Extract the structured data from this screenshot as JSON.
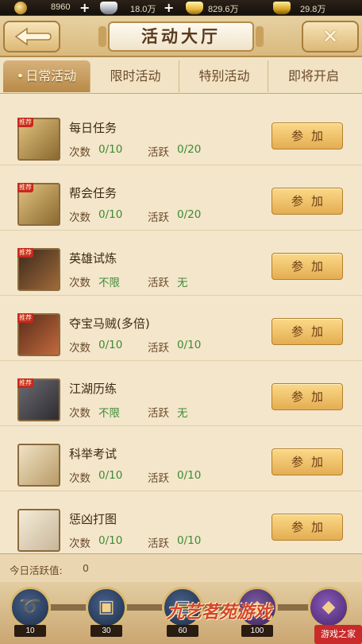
{
  "currency": [
    {
      "icon": "coin-icon",
      "value": "8960",
      "has_plus": true
    },
    {
      "icon": "silver-icon",
      "value": "18.0万",
      "has_plus": true
    },
    {
      "icon": "gold-ingot-icon",
      "value": "829.6万",
      "has_plus": false
    },
    {
      "icon": "yuanbao-icon",
      "value": "29.8万",
      "has_plus": false
    }
  ],
  "header": {
    "title": "活动大厅",
    "back_icon": "back-arrow-icon",
    "close_icon": "close-icon",
    "close_glyph": "✕"
  },
  "tabs": [
    {
      "label": "日常活动",
      "active": true
    },
    {
      "label": "限时活动",
      "active": false
    },
    {
      "label": "特别活动",
      "active": false
    },
    {
      "label": "即将开启",
      "active": false
    }
  ],
  "labels": {
    "count": "次数",
    "activity": "活跃",
    "join": "参加",
    "recommend": "推荐"
  },
  "activities": [
    {
      "name": "每日任务",
      "count": "0/10",
      "activity": "0/20",
      "icon": "task-ticket-icon",
      "recommended": true
    },
    {
      "name": "帮会任务",
      "count": "0/10",
      "activity": "0/20",
      "icon": "guild-ticket-icon",
      "recommended": true
    },
    {
      "name": "英雄试炼",
      "count": "不限",
      "activity": "无",
      "icon": "hero-trial-icon",
      "recommended": true
    },
    {
      "name": "夺宝马贼(多倍)",
      "count": "0/10",
      "activity": "0/10",
      "icon": "horse-bandit-icon",
      "recommended": true
    },
    {
      "name": "江湖历练",
      "count": "不限",
      "activity": "无",
      "icon": "jianghu-icon",
      "recommended": true
    },
    {
      "name": "科举考试",
      "count": "0/10",
      "activity": "0/10",
      "icon": "exam-scroll-icon",
      "recommended": false
    },
    {
      "name": "惩凶打图",
      "count": "0/10",
      "activity": "0/10",
      "icon": "wanted-poster-icon",
      "recommended": false
    }
  ],
  "today": {
    "label": "今日活跃值:",
    "value": "0"
  },
  "rewards": [
    {
      "threshold": "10",
      "icon": "whip-icon"
    },
    {
      "threshold": "30",
      "icon": "treasure-chest-icon"
    },
    {
      "threshold": "60",
      "icon": "scroll-chest-icon"
    },
    {
      "threshold": "100",
      "icon": "silver-chest-icon"
    },
    {
      "threshold": "",
      "icon": "purple-chest-icon"
    }
  ],
  "watermark": "九艺茗苑游戏",
  "logo": "游戏之家"
}
